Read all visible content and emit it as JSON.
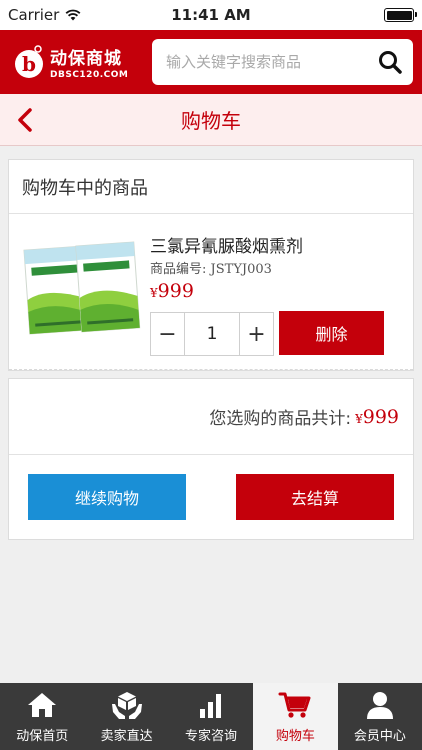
{
  "status_bar": {
    "carrier": "Carrier",
    "time": "11:41 AM"
  },
  "header": {
    "logo_name": "动保商城",
    "logo_domain": "DBSC120.COM",
    "search_placeholder": "输入关键字搜索商品"
  },
  "title_bar": {
    "title": "购物车"
  },
  "cart": {
    "section_title": "购物车中的商品",
    "items": [
      {
        "name": "三氯异氰脲酸烟熏剂",
        "code_label": "商品编号:",
        "code": "JSTYJ003",
        "currency": "¥",
        "price": "999",
        "quantity": "1",
        "minus_label": "−",
        "plus_label": "+",
        "delete_label": "删除"
      }
    ]
  },
  "summary": {
    "total_label": "您选购的商品共计:",
    "currency": "¥",
    "total": "999",
    "continue_label": "继续购物",
    "checkout_label": "去结算"
  },
  "tab_bar": {
    "items": [
      {
        "label": "动保首页",
        "icon": "home-icon",
        "active": false
      },
      {
        "label": "卖家直达",
        "icon": "hands-box-icon",
        "active": false
      },
      {
        "label": "专家咨询",
        "icon": "bar-chart-icon",
        "active": false
      },
      {
        "label": "购物车",
        "icon": "cart-icon",
        "active": true
      },
      {
        "label": "会员中心",
        "icon": "user-icon",
        "active": false
      }
    ]
  },
  "colors": {
    "brand_red": "#c4000b",
    "accent_blue": "#1a8fd6",
    "tabbar_bg": "#3a3a3a"
  }
}
